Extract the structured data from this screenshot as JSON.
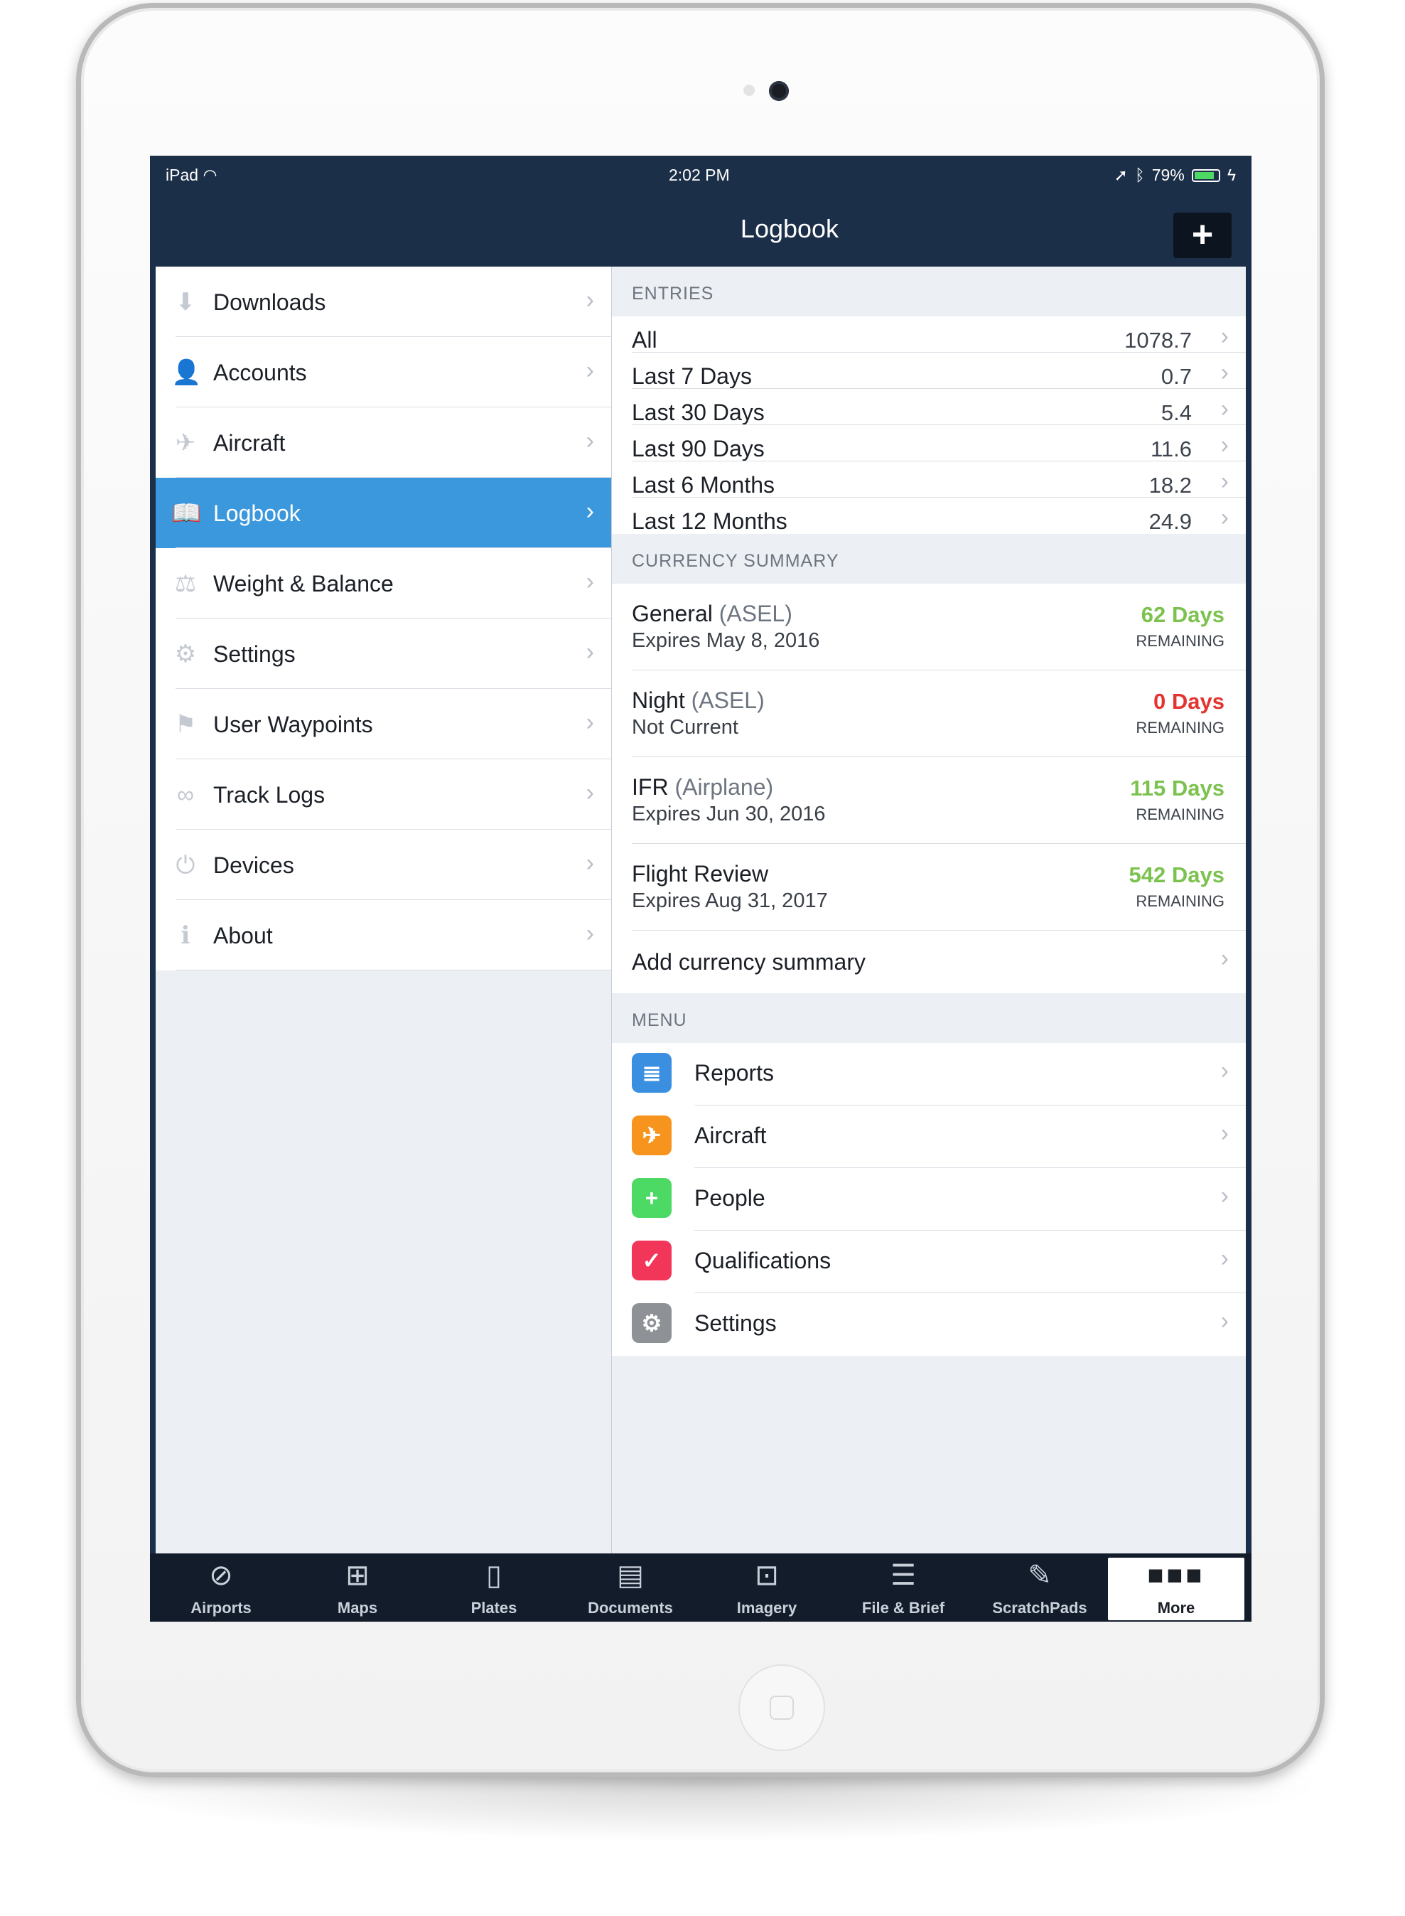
{
  "status": {
    "device": "iPad",
    "time": "2:02 PM",
    "battery": "79%"
  },
  "nav": {
    "title": "Logbook",
    "add_label": "+"
  },
  "sidebar": {
    "items": [
      {
        "label": "Downloads",
        "icon": "download-icon",
        "glyph": "⬇"
      },
      {
        "label": "Accounts",
        "icon": "person-icon",
        "glyph": "👤"
      },
      {
        "label": "Aircraft",
        "icon": "airplane-icon",
        "glyph": "✈"
      },
      {
        "label": "Logbook",
        "icon": "book-icon",
        "glyph": "📖"
      },
      {
        "label": "Weight & Balance",
        "icon": "weight-icon",
        "glyph": "⚖"
      },
      {
        "label": "Settings",
        "icon": "gear-icon",
        "glyph": "⚙"
      },
      {
        "label": "User Waypoints",
        "icon": "flag-icon",
        "glyph": "⚑"
      },
      {
        "label": "Track Logs",
        "icon": "track-log-icon",
        "glyph": "∞"
      },
      {
        "label": "Devices",
        "icon": "plug-icon",
        "glyph": "⏻"
      },
      {
        "label": "About",
        "icon": "info-icon",
        "glyph": "ℹ"
      }
    ],
    "active_index": 3
  },
  "entries": {
    "header": "ENTRIES",
    "rows": [
      {
        "label": "All",
        "value": "1078.7"
      },
      {
        "label": "Last 7 Days",
        "value": "0.7"
      },
      {
        "label": "Last 30 Days",
        "value": "5.4"
      },
      {
        "label": "Last 90 Days",
        "value": "11.6"
      },
      {
        "label": "Last 6 Months",
        "value": "18.2"
      },
      {
        "label": "Last 12 Months",
        "value": "24.9"
      }
    ]
  },
  "currency": {
    "header": "CURRENCY SUMMARY",
    "items": [
      {
        "name": "General",
        "qual": "(ASEL)",
        "status": "Expires May 8, 2016",
        "days": "62 Days",
        "remaining": "REMAINING",
        "color": "#7cc24f"
      },
      {
        "name": "Night",
        "qual": "(ASEL)",
        "status": "Not Current",
        "days": "0 Days",
        "remaining": "REMAINING",
        "color": "#e3342f"
      },
      {
        "name": "IFR",
        "qual": "(Airplane)",
        "status": "Expires Jun 30, 2016",
        "days": "115 Days",
        "remaining": "REMAINING",
        "color": "#7cc24f"
      },
      {
        "name": "Flight Review",
        "qual": "",
        "status": "Expires Aug 31, 2017",
        "days": "542 Days",
        "remaining": "REMAINING",
        "color": "#7cc24f"
      }
    ],
    "add_label": "Add currency summary"
  },
  "menu": {
    "header": "MENU",
    "items": [
      {
        "label": "Reports",
        "icon": "reports-icon",
        "glyph": "≣",
        "color": "#3b8fe0"
      },
      {
        "label": "Aircraft",
        "icon": "airplane-icon",
        "glyph": "✈",
        "color": "#f7941d"
      },
      {
        "label": "People",
        "icon": "add-person-icon",
        "glyph": "+",
        "color": "#4cd964"
      },
      {
        "label": "Qualifications",
        "icon": "badge-check-icon",
        "glyph": "✓",
        "color": "#f2365a"
      },
      {
        "label": "Settings",
        "icon": "gears-icon",
        "glyph": "⚙",
        "color": "#8e9196"
      }
    ]
  },
  "tabs": [
    {
      "label": "Airports",
      "icon": "compass-icon",
      "glyph": "⊘"
    },
    {
      "label": "Maps",
      "icon": "map-icon",
      "glyph": "⊞"
    },
    {
      "label": "Plates",
      "icon": "plates-icon",
      "glyph": "▯"
    },
    {
      "label": "Documents",
      "icon": "documents-icon",
      "glyph": "▤"
    },
    {
      "label": "Imagery",
      "icon": "imagery-icon",
      "glyph": "⊡"
    },
    {
      "label": "File & Brief",
      "icon": "file-brief-icon",
      "glyph": "☰"
    },
    {
      "label": "ScratchPads",
      "icon": "scratchpad-icon",
      "glyph": "✎"
    },
    {
      "label": "More",
      "icon": "more-icon",
      "glyph": "■■■"
    }
  ],
  "tab_selected_index": 7
}
